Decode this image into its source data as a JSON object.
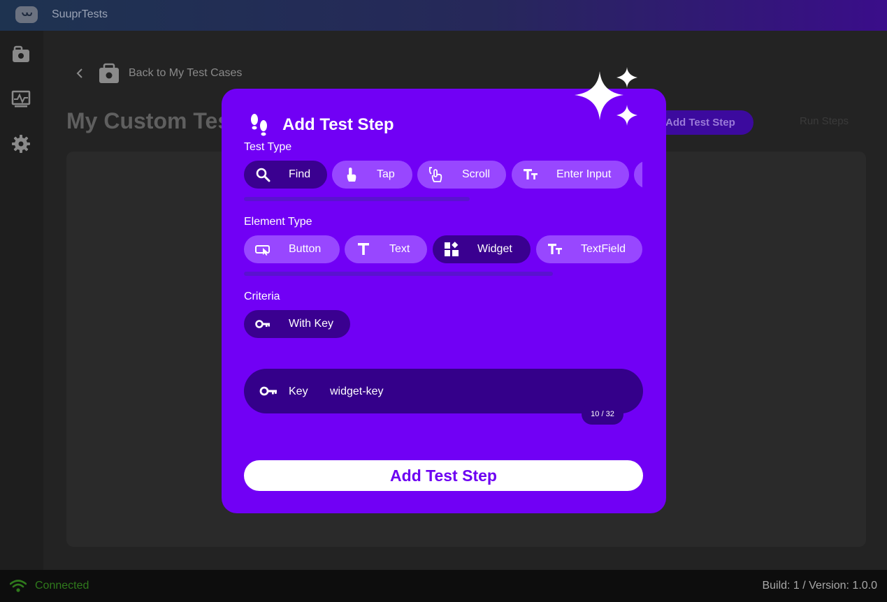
{
  "app": {
    "title": "SuuprTests"
  },
  "sidebar": {
    "items": [
      {
        "icon": "test-cases-icon"
      },
      {
        "icon": "monitor-icon"
      },
      {
        "icon": "gear-icon"
      }
    ]
  },
  "main": {
    "back_label": "Back to My Test Cases",
    "page_title": "My Custom Test",
    "add_step_label": "Add Test Step",
    "run_steps_label": "Run Steps"
  },
  "dialog": {
    "title": "Add Test Step",
    "test_type": {
      "label": "Test Type",
      "options": [
        {
          "label": "Find",
          "icon": "search-icon",
          "selected": true
        },
        {
          "label": "Tap",
          "icon": "tap-icon",
          "selected": false
        },
        {
          "label": "Scroll",
          "icon": "scroll-icon",
          "selected": false
        },
        {
          "label": "Enter Input",
          "icon": "text-format-icon",
          "selected": false
        }
      ]
    },
    "element_type": {
      "label": "Element Type",
      "options": [
        {
          "label": "Button",
          "icon": "button-icon",
          "selected": false
        },
        {
          "label": "Text",
          "icon": "text-icon",
          "selected": false
        },
        {
          "label": "Widget",
          "icon": "widget-icon",
          "selected": true
        },
        {
          "label": "TextField",
          "icon": "text-format-icon",
          "selected": false
        }
      ]
    },
    "criteria": {
      "label": "Criteria",
      "options": [
        {
          "label": "With Key",
          "icon": "key-icon",
          "selected": true
        }
      ]
    },
    "key_field": {
      "label": "Key",
      "value": "widget-key",
      "counter": "10 / 32"
    },
    "submit_label": "Add Test Step"
  },
  "status": {
    "connection": "Connected",
    "build": "Build: 1 / Version: 1.0.0"
  },
  "colors": {
    "accent": "#7100f5",
    "chip": "#9847ff",
    "chip_selected": "#3a0090",
    "connected": "#2f7a1c"
  }
}
